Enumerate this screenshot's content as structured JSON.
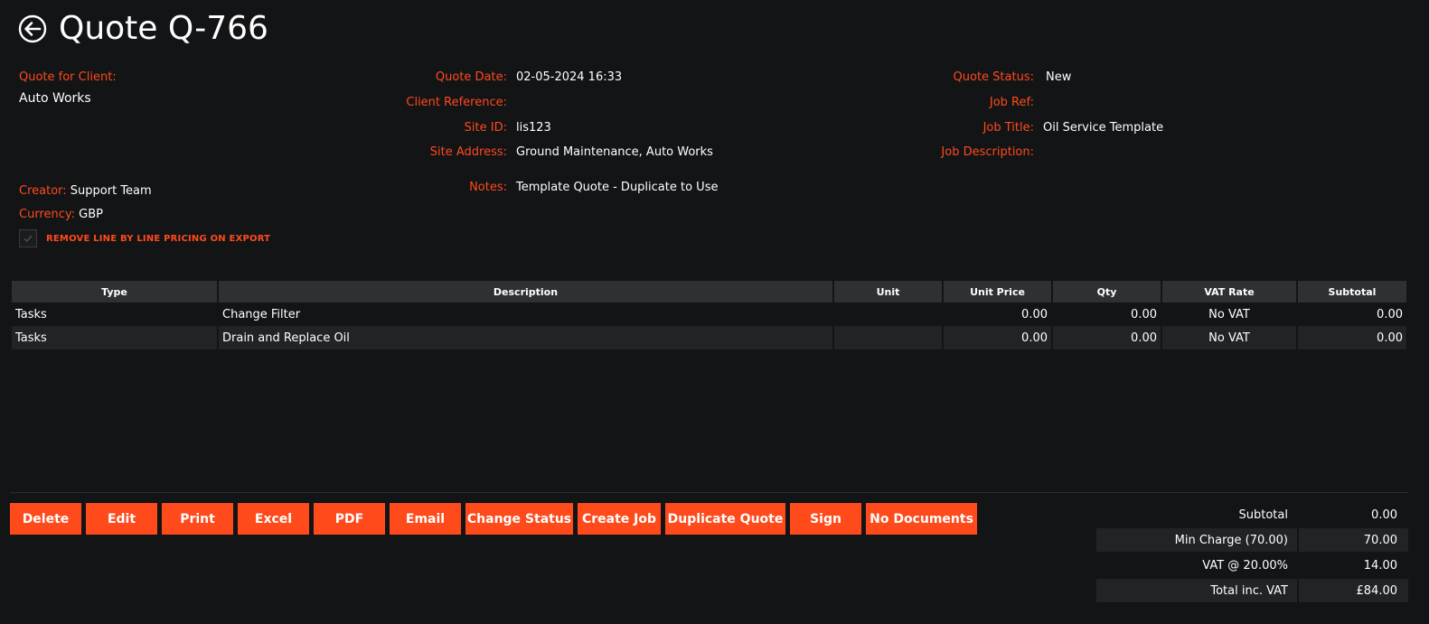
{
  "header": {
    "title": "Quote Q-766"
  },
  "client": {
    "label": "Quote for Client:",
    "name": "Auto Works"
  },
  "col2": [
    {
      "label": "Quote Date:",
      "value": "02-05-2024 16:33"
    },
    {
      "label": "Client Reference:",
      "value": ""
    },
    {
      "label": "Site ID:",
      "value": "lis123"
    },
    {
      "label": "Site Address:",
      "value": "Ground Maintenance, Auto Works"
    },
    {
      "label": "Notes:",
      "value": "Template Quote - Duplicate to Use"
    }
  ],
  "col3": [
    {
      "label": "Quote Status:",
      "value": "New"
    },
    {
      "label": "Job Ref:",
      "value": ""
    },
    {
      "label": "Job Title:",
      "value": "Oil Service Template"
    },
    {
      "label": "Job Description:",
      "value": ""
    }
  ],
  "meta": {
    "creator_label": "Creator:",
    "creator": "Support Team",
    "currency_label": "Currency:",
    "currency": "GBP",
    "remove_pricing_label": "REMOVE LINE BY LINE PRICING ON EXPORT"
  },
  "table": {
    "headers": [
      "Type",
      "Description",
      "Unit",
      "Unit Price",
      "Qty",
      "VAT Rate",
      "Subtotal"
    ],
    "rows": [
      [
        "Tasks",
        "Change Filter",
        "",
        "0.00",
        "0.00",
        "No VAT",
        "0.00"
      ],
      [
        "Tasks",
        "Drain and Replace Oil",
        "",
        "0.00",
        "0.00",
        "No VAT",
        "0.00"
      ]
    ]
  },
  "buttons": {
    "delete": "Delete",
    "edit": "Edit",
    "print": "Print",
    "excel": "Excel",
    "pdf": "PDF",
    "email": "Email",
    "change_status": "Change Status",
    "create_job": "Create Job",
    "duplicate": "Duplicate Quote",
    "sign": "Sign",
    "documents": "No Documents"
  },
  "totals": [
    {
      "label": "Subtotal",
      "value": "0.00"
    },
    {
      "label": "Min Charge (70.00)",
      "value": "70.00"
    },
    {
      "label": "VAT @ 20.00%",
      "value": "14.00"
    },
    {
      "label": "Total inc. VAT",
      "value": "£84.00"
    }
  ],
  "colors": {
    "accent": "#ff4a1c",
    "background": "#131416"
  }
}
